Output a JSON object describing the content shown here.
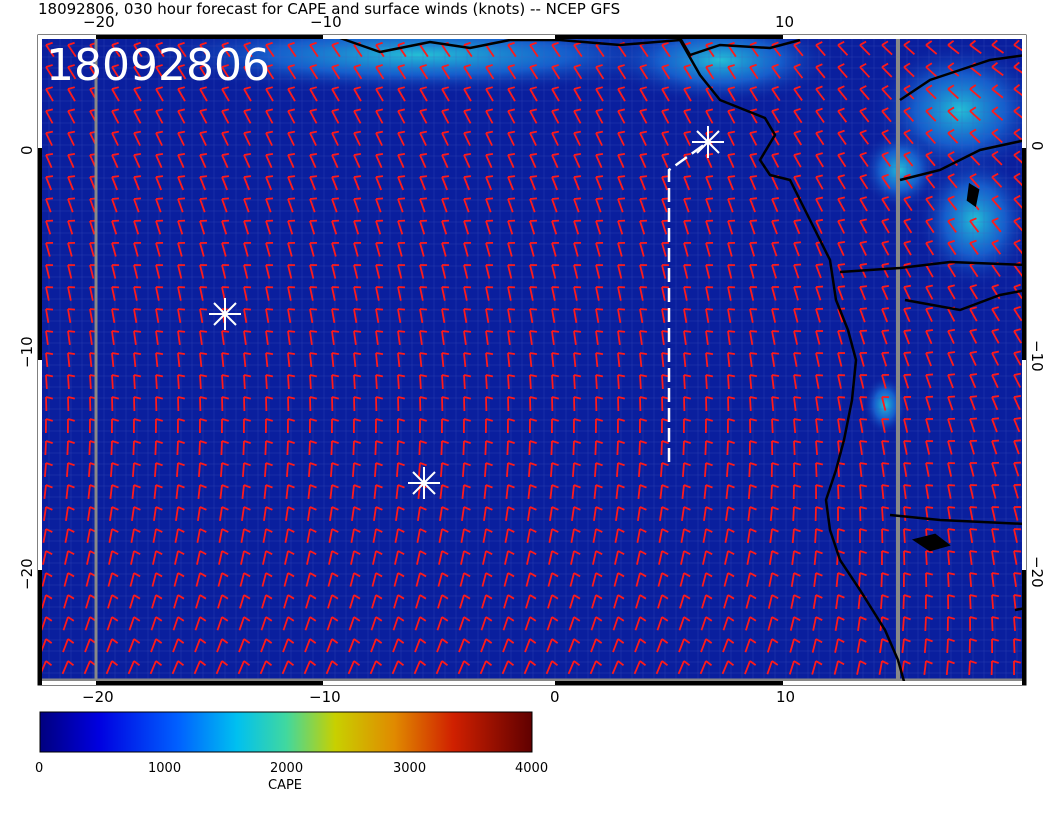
{
  "title": "18092806, 030 hour forecast for CAPE and surface winds (knots) -- NCEP GFS",
  "stamp": "18092806",
  "axes": {
    "x_top_ticks": [
      "−20",
      "−10",
      "10"
    ],
    "x_bottom_ticks": [
      "−20",
      "−10",
      "0",
      "10"
    ],
    "y_left_ticks": [
      "0",
      "−10",
      "−20"
    ],
    "y_right_ticks": [
      "0",
      "−10",
      "−20"
    ]
  },
  "colorbar": {
    "label": "CAPE",
    "tick_labels": [
      "0",
      "1000",
      "2000",
      "3000",
      "4000"
    ],
    "range": [
      0,
      4000
    ],
    "colors": [
      "#00007f",
      "#0000cc",
      "#0055ff",
      "#00b4ff",
      "#10d8c8",
      "#8ed66a",
      "#d6d000",
      "#e08a00",
      "#d02a00",
      "#a00000",
      "#600000"
    ]
  },
  "map_colors": {
    "ocean_cape_low": "#0a1f9e",
    "cape_mid": "#1e5fd8",
    "cape_high": "#1fc4d8",
    "wind_barb": "#ff1a1a",
    "coastline": "#000000",
    "markers": "#ffffff"
  },
  "legend_markers": [
    "asterisk-1",
    "asterisk-2",
    "asterisk-3"
  ]
}
